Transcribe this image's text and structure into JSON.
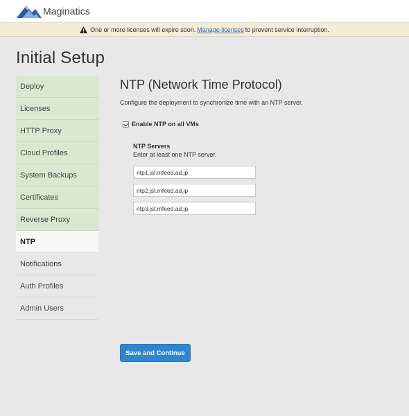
{
  "header": {
    "brand": "Maginatics",
    "logo_icon": "mountain-logo-icon"
  },
  "banner": {
    "icon": "warning-icon",
    "text_before": "One or more licenses will expire soon.",
    "link": "Manage licenses",
    "text_after": "to prevent service interruption."
  },
  "page": {
    "title": "Initial Setup"
  },
  "sidebar": {
    "items": [
      {
        "label": "Deploy",
        "state": "done"
      },
      {
        "label": "Licenses",
        "state": "done"
      },
      {
        "label": "HTTP Proxy",
        "state": "done"
      },
      {
        "label": "Cloud Profiles",
        "state": "done"
      },
      {
        "label": "System Backups",
        "state": "done"
      },
      {
        "label": "Certificates",
        "state": "done"
      },
      {
        "label": "Reverse Proxy",
        "state": "done"
      },
      {
        "label": "NTP",
        "state": "active"
      },
      {
        "label": "Notifications",
        "state": "pending"
      },
      {
        "label": "Auth Profiles",
        "state": "pending"
      },
      {
        "label": "Admin Users",
        "state": "pending"
      }
    ]
  },
  "ntp": {
    "heading": "NTP (Network Time Protocol)",
    "description": "Configure the deployment to synchronize time with an NTP server.",
    "enable_label": "Enable NTP on all VMs",
    "enabled": true,
    "servers_label": "NTP Servers",
    "servers_hint": "Enter at least one NTP server.",
    "servers": [
      "ntp1.jst.mfeed.ad.jp",
      "ntp2.jst.mfeed.ad.jp",
      "ntp3.jst.mfeed.ad.jp"
    ]
  },
  "actions": {
    "save_label": "Save and Continue"
  },
  "colors": {
    "accent": "#2f86cf",
    "sidebar_done": "#d9e8cf",
    "banner_bg": "#f4ecd7",
    "link": "#2a6ebd"
  }
}
